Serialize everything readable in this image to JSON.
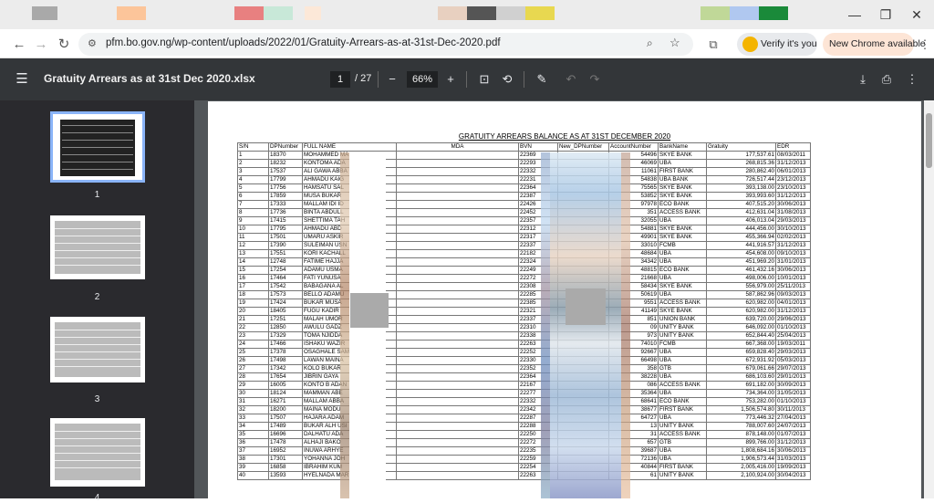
{
  "tabbar": {
    "blocks": [
      "#a9a9a9",
      "#fcc59a",
      "#e88080",
      "#c8e8d8",
      "#fce8d8",
      "#e8d0c0",
      "#555555",
      "#d0d0d0",
      "#e8d850",
      "#c0d898",
      "#b0c8f0",
      "#1a8a3a"
    ],
    "controls": {
      "minimize": "—",
      "maximize": "❐",
      "close": "✕"
    }
  },
  "omnibox": {
    "url": "pfm.bo.gov.ng/wp-content/uploads/2022/01/Gratuity-Arrears-as-at-31st-Dec-2020.pdf",
    "verify_label": "Verify it's you",
    "chrome_update_label": "New Chrome available"
  },
  "pdf_toolbar": {
    "title": "Gratuity Arrears as at 31st Dec 2020.xlsx",
    "current_page": "1",
    "total_pages": "/ 27",
    "zoom": "66%"
  },
  "thumbnails": [
    {
      "label": "1"
    },
    {
      "label": "2"
    },
    {
      "label": "3"
    },
    {
      "label": "4"
    }
  ],
  "document": {
    "title": "GRATUITY ARREARS BALANCE AS AT 31ST DECEMBER 2020",
    "headers": [
      "S/N",
      "DPNumber",
      "FULL NAME",
      "MDA",
      "BVN",
      "New_DPNumber",
      "AccountNumber",
      "BankName",
      "Gratuity",
      "EDR"
    ],
    "rows": [
      [
        "1",
        "18370",
        "MOHAMMED MA",
        "22369",
        "54496",
        "SKYE BANK",
        "177,537.61",
        "08/03/2011"
      ],
      [
        "2",
        "18232",
        "KONTOMA ADA",
        "22293",
        "46069",
        "UBA",
        "268,815.36",
        "31/12/2013"
      ],
      [
        "3",
        "17537",
        "ALI GAWA ABBA",
        "22332",
        "11061",
        "FIRST BANK",
        "280,862.40",
        "06/01/2013"
      ],
      [
        "4",
        "17799",
        "AHMADU KAIG",
        "22231",
        "54838",
        "UBA BANK",
        "726,517.44",
        "23/12/2013"
      ],
      [
        "5",
        "17756",
        "HAMSATU SAL",
        "22364",
        "75565",
        "SKYE BANK",
        "393,138.00",
        "23/10/2013"
      ],
      [
        "6",
        "17859",
        "MUSA BUKAR",
        "22387",
        "53852",
        "SKYE BANK",
        "393,993.60",
        "31/12/2013"
      ],
      [
        "7",
        "17333",
        "MALLAM IDI ID",
        "22426",
        "97978",
        "ECO BANK",
        "407,515.20",
        "30/06/2013"
      ],
      [
        "8",
        "17736",
        "BINTA ABDULL",
        "22452",
        "351",
        "ACCESS BANK",
        "412,631.04",
        "31/08/2013"
      ],
      [
        "9",
        "17415",
        "SHETTIMA TAH",
        "22357",
        "32055",
        "UBA",
        "406,013.04",
        "29/03/2013"
      ],
      [
        "10",
        "17795",
        "AHMADU ABD",
        "22312",
        "54881",
        "SKYE BANK",
        "444,456.00",
        "30/10/2013"
      ],
      [
        "11",
        "17501",
        "UMARU ASKIR",
        "22317",
        "49901",
        "SKYE BANK",
        "455,366.94",
        "02/02/2013"
      ],
      [
        "12",
        "17390",
        "SULEIMAN USN",
        "22337",
        "33010",
        "FCMB",
        "441,916.57",
        "31/12/2013"
      ],
      [
        "13",
        "17551",
        "KORI KACHALL",
        "22182",
        "48684",
        "UBA",
        "454,608.00",
        "09/10/2013"
      ],
      [
        "14",
        "12748",
        "FATIME HAJJA",
        "22324",
        "34342",
        "UBA",
        "451,969.20",
        "31/01/2013"
      ],
      [
        "15",
        "17254",
        "ADAMU USMA",
        "22249",
        "48815",
        "ECO BANK",
        "461,432.16",
        "30/06/2013"
      ],
      [
        "16",
        "17464",
        "FATI YUNUSA",
        "22272",
        "21668",
        "UBA",
        "498,006.00",
        "10/01/2013"
      ],
      [
        "17",
        "17542",
        "BABAGANA AL",
        "22308",
        "58434",
        "SKYE BANK",
        "556,979.00",
        "25/11/2013"
      ],
      [
        "18",
        "17573",
        "BELLO ADAMU",
        "22285",
        "50619",
        "UBA",
        "587,862.96",
        "09/03/2013"
      ],
      [
        "19",
        "17424",
        "BUKAR MUSA",
        "22385",
        "9551",
        "ACCESS BANK",
        "620,982.00",
        "04/01/2013"
      ],
      [
        "20",
        "18405",
        "FUGU KADIR",
        "22321",
        "41149",
        "SKYE BANK",
        "620,982.00",
        "31/12/2013"
      ],
      [
        "21",
        "17251",
        "MALAH UMOR",
        "22337",
        "851",
        "UNION BANK",
        "639,720.00",
        "29/06/2013"
      ],
      [
        "22",
        "12850",
        "AWULU GADZ",
        "22310",
        "09",
        "UNITY BANK",
        "646,092.00",
        "01/10/2013"
      ],
      [
        "23",
        "17329",
        "TOMA NJIDDA",
        "22338",
        "973",
        "UNITY BANK",
        "652,844.40",
        "25/04/2013"
      ],
      [
        "24",
        "17466",
        "ISHAKU WAZIR",
        "22263",
        "74010",
        "FCMB",
        "667,368.00",
        "19/03/2011"
      ],
      [
        "25",
        "17378",
        "OSAGHALE SAM",
        "22252",
        "92667",
        "UBA",
        "659,828.40",
        "29/03/2013"
      ],
      [
        "26",
        "17498",
        "LAWAN MAINA",
        "22330",
        "66498",
        "UBA",
        "672,931.92",
        "05/03/2013"
      ],
      [
        "27",
        "17342",
        "KOLO BUKAR",
        "22352",
        "358",
        "GTB",
        "679,061.66",
        "29/07/2013"
      ],
      [
        "28",
        "17654",
        "JIBRIN GAYA",
        "22364",
        "38228",
        "UBA",
        "686,103.60",
        "29/01/2013"
      ],
      [
        "29",
        "16005",
        "KONTO B ADAN",
        "22167",
        "086",
        "ACCESS BANK",
        "691,182.00",
        "30/09/2013"
      ],
      [
        "30",
        "18124",
        "MAMMAN ABE",
        "22277",
        "35364",
        "UBA",
        "734,364.00",
        "31/05/2013"
      ],
      [
        "31",
        "16271",
        "MALLAM ABBA",
        "22332",
        "68641",
        "ECO BANK",
        "753,282.00",
        "01/10/2013"
      ],
      [
        "32",
        "18200",
        "MAINA MODU",
        "22342",
        "38677",
        "FIRST BANK",
        "1,506,574.80",
        "30/11/2013"
      ],
      [
        "33",
        "17507",
        "HAJARA ADAM",
        "22287",
        "64727",
        "UBA",
        "773,446.32",
        "27/04/2013"
      ],
      [
        "34",
        "17489",
        "BUKAR ALH USI",
        "22288",
        "13",
        "UNITY BANK",
        "788,007.60",
        "24/07/2013"
      ],
      [
        "35",
        "16696",
        "DALHATU ADA",
        "22250",
        "31",
        "ACCESS BANK",
        "878,148.00",
        "01/07/2013"
      ],
      [
        "36",
        "17478",
        "ALHAJI BAKO",
        "22272",
        "657",
        "GTB",
        "899,766.00",
        "31/12/2013"
      ],
      [
        "37",
        "16952",
        "INUWA ARHYE",
        "22235",
        "39687",
        "UBA",
        "1,808,684.16",
        "30/06/2013"
      ],
      [
        "38",
        "17301",
        "YOHANNA JOH",
        "22259",
        "72136",
        "UBA",
        "1,906,573.44",
        "31/03/2013"
      ],
      [
        "39",
        "16858",
        "IBRAHIM KUM",
        "22254",
        "40844",
        "FIRST BANK",
        "2,005,416.00",
        "19/09/2013"
      ],
      [
        "40",
        "13593",
        "HYELNADA MAR",
        "22263",
        "61",
        "UNITY BANK",
        "2,100,924.00",
        "30/04/2013"
      ]
    ]
  }
}
